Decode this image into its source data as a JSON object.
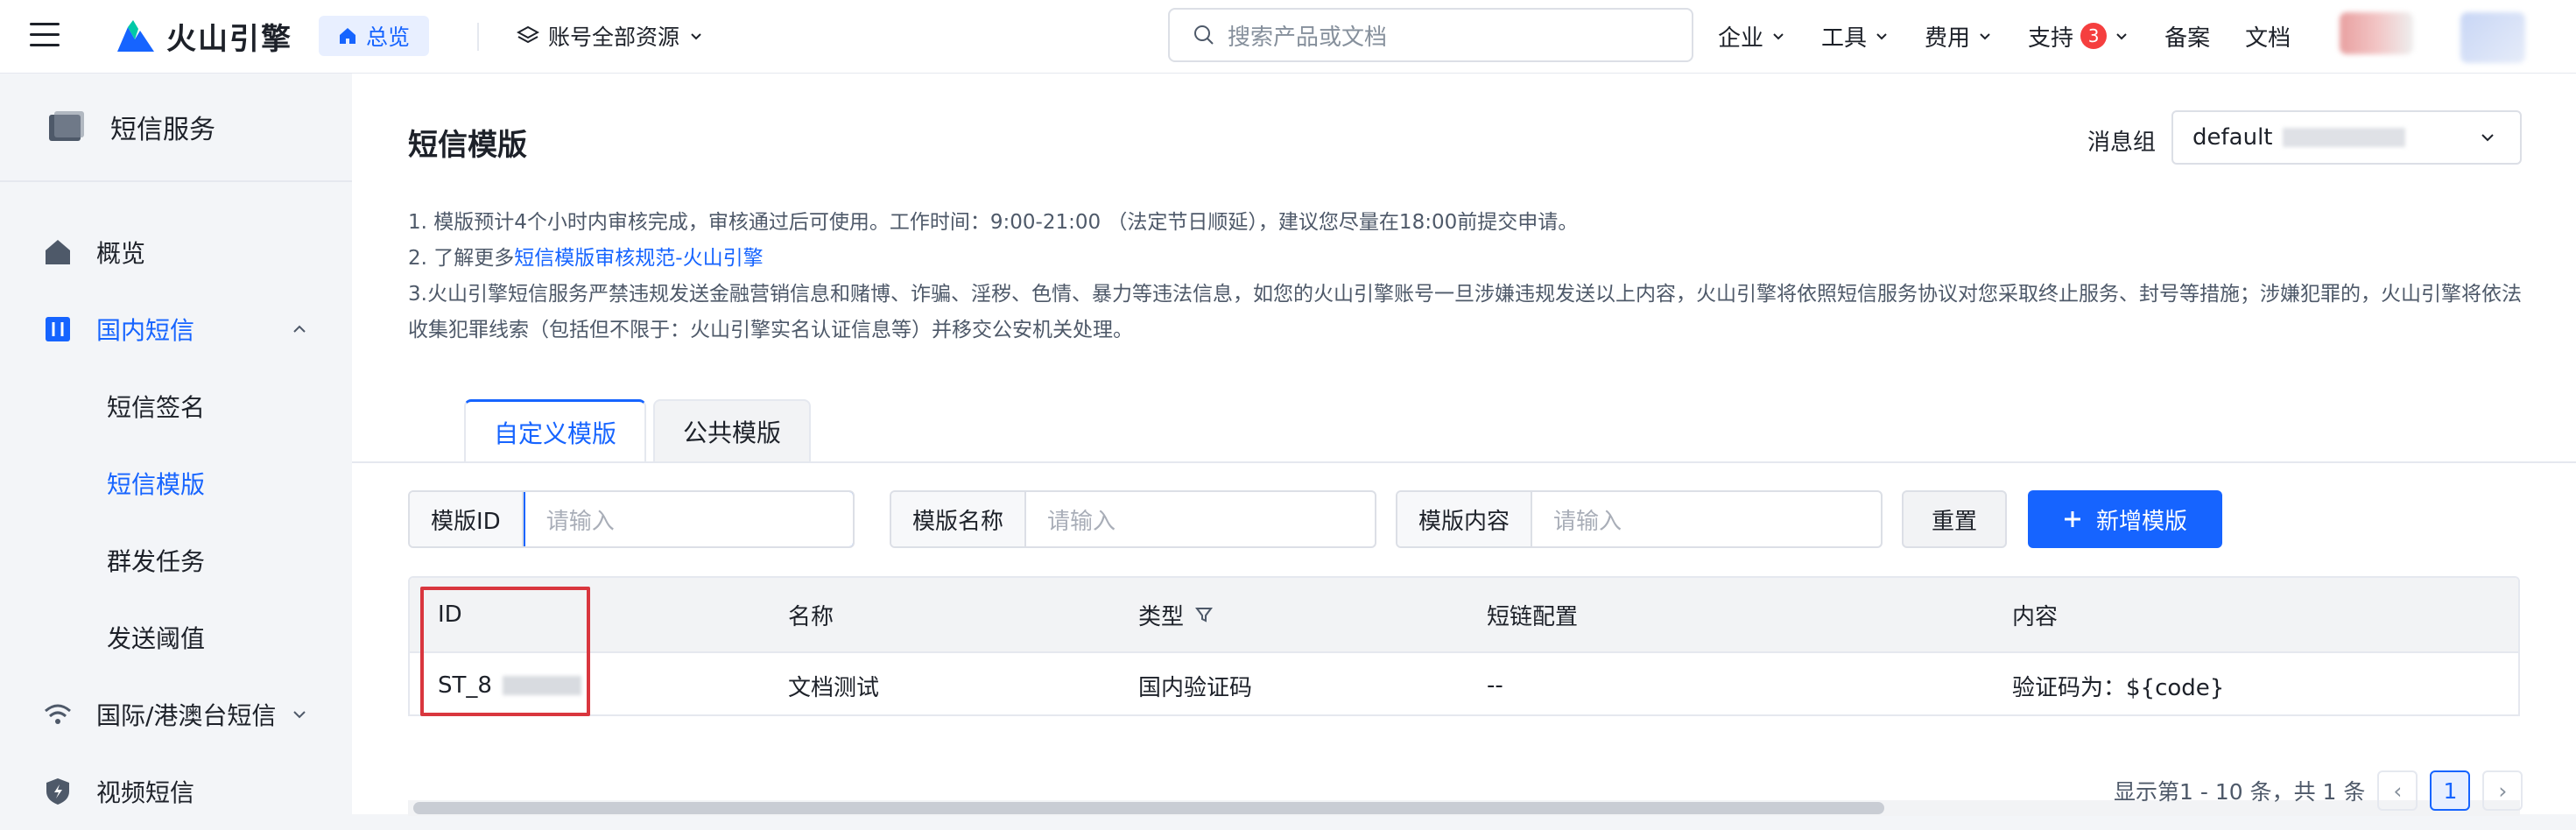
{
  "topbar": {
    "brand": "火山引擎",
    "overview": "总览",
    "resource_scope": "账号全部资源",
    "search_placeholder": "搜索产品或文档",
    "nav": [
      {
        "label": "企业",
        "has_chevron": true
      },
      {
        "label": "工具",
        "has_chevron": true
      },
      {
        "label": "费用",
        "has_chevron": true
      },
      {
        "label": "支持",
        "has_chevron": true,
        "badge": "3"
      },
      {
        "label": "备案",
        "has_chevron": false
      },
      {
        "label": "文档",
        "has_chevron": false
      }
    ]
  },
  "sidebar": {
    "header": "短信服务",
    "items": [
      {
        "label": "概览",
        "icon": "home-icon"
      },
      {
        "label": "国内短信",
        "icon": "sms-domestic-icon",
        "expanded": true,
        "active": true
      },
      {
        "label": "短信签名",
        "sub": true
      },
      {
        "label": "短信模版",
        "sub": true,
        "active": true
      },
      {
        "label": "群发任务",
        "sub": true
      },
      {
        "label": "发送阈值",
        "sub": true
      },
      {
        "label": "国际/港澳台短信",
        "icon": "wifi-icon",
        "collapsed": true
      },
      {
        "label": "视频短信",
        "icon": "shield-icon"
      }
    ]
  },
  "main": {
    "title": "短信模版",
    "message_group_label": "消息组",
    "message_group_value": "default",
    "notes": [
      "1. 模版预计4个小时内审核完成，审核通过后可使用。工作时间：9:00-21:00 （法定节日顺延），建议您尽量在18:00前提交申请。",
      "2. 了解更多",
      "短信模版审核规范-火山引擎",
      "3.火山引擎短信服务严禁违规发送金融营销信息和赌博、诈骗、淫秽、色情、暴力等违法信息，如您的火山引擎账号一旦涉嫌违规发送以上内容，火山引擎将依照短信服务协议对您采取终止服务、封号等措施；涉嫌犯罪的，火山引擎将依法收集犯罪线索（包括但不限于：火山引擎实名认证信息等）并移交公安机关处理。"
    ],
    "tabs": [
      "自定义模版",
      "公共模版"
    ],
    "filters": [
      {
        "label": "模版ID",
        "placeholder": "请输入"
      },
      {
        "label": "模版名称",
        "placeholder": "请输入"
      },
      {
        "label": "模版内容",
        "placeholder": "请输入"
      }
    ],
    "reset_label": "重置",
    "add_label": "新增模版",
    "table": {
      "headers": [
        "ID",
        "名称",
        "类型",
        "短链配置",
        "内容"
      ],
      "rows": [
        {
          "id": "ST_8",
          "name": "文档测试",
          "type": "国内验证码",
          "shortlink": "--",
          "content": "验证码为：${code}"
        }
      ]
    },
    "pager": {
      "summary": "显示第1 - 10 条，共 1 条",
      "prev": "‹",
      "current": "1",
      "next": "›"
    }
  },
  "colors": {
    "accent": "#1664ff",
    "highlight": "#d9363e"
  }
}
